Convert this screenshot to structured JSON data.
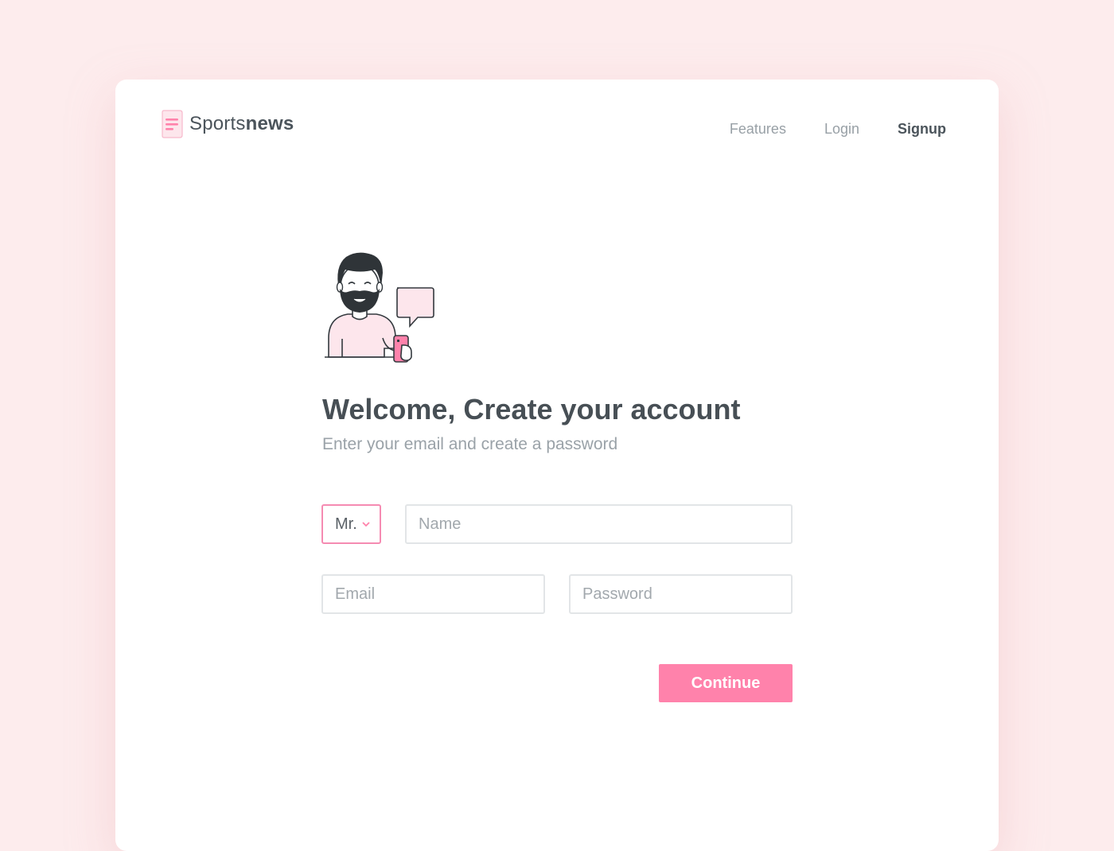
{
  "brand": {
    "light": "Sports",
    "bold": "news",
    "accent": "#ff82ab"
  },
  "nav": {
    "items": [
      {
        "label": "Features",
        "active": false
      },
      {
        "label": "Login",
        "active": false
      },
      {
        "label": "Signup",
        "active": true
      }
    ]
  },
  "hero": {
    "title": "Welcome, Create your account",
    "subtitle": "Enter your email and create a password"
  },
  "form": {
    "title_select": {
      "value": "Mr."
    },
    "name": {
      "placeholder": "Name",
      "value": ""
    },
    "email": {
      "placeholder": "Email",
      "value": ""
    },
    "password": {
      "placeholder": "Password",
      "value": ""
    },
    "submit_label": "Continue"
  },
  "icons": {
    "logo": "document-lines-icon",
    "select": "chevron-down-icon",
    "illustration": "man-with-phone-illustration"
  },
  "colors": {
    "background": "#fdeced",
    "card": "#ffffff",
    "text_dark": "#474f55",
    "text_muted": "#9aa2a8",
    "select_border": "#f58bb2"
  }
}
